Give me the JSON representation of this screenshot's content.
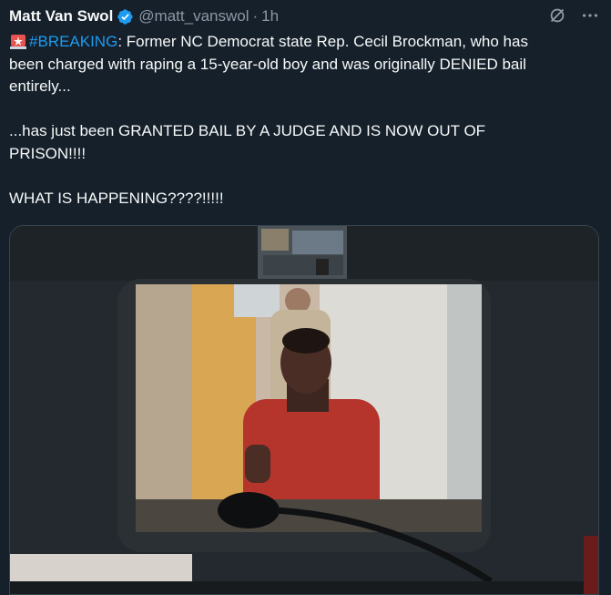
{
  "author": {
    "name": "Matt Van Swol",
    "handle": "@matt_vanswol",
    "separator": "·",
    "time": "1h"
  },
  "icons": {
    "verified": "verified-badge-icon",
    "grok": "grok-icon",
    "more": "more-options-icon",
    "siren": "police-light-emoji"
  },
  "colors": {
    "background": "#15202b",
    "accent": "#1d9bf0",
    "muted": "#8b98a5",
    "text": "#f7f9f9"
  },
  "tweet": {
    "hashtag": "#BREAKING",
    "line1_rest": ": Former NC Democrat state Rep. Cecil Brockman, who has",
    "line2": "been charged with raping a 15-year-old boy and was originally DENIED bail",
    "line3": "entirely...",
    "line4": "...has just been GRANTED BAIL BY A JUDGE AND IS  NOW OUT OF",
    "line5": "PRISON!!!!",
    "line6": "WHAT IS HAPPENING????!!!!!"
  },
  "media": {
    "description_icon": "video-thumbnail"
  }
}
